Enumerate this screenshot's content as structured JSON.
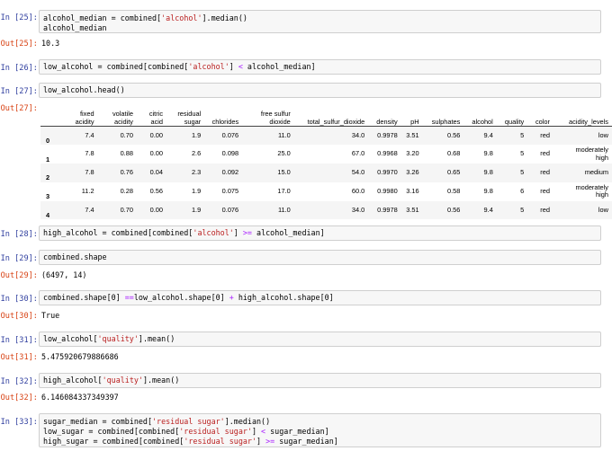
{
  "cells": [
    {
      "in": "In [25]:",
      "out": "Out[25]:",
      "output": "10.3"
    },
    {
      "in": "In [26]:"
    },
    {
      "in": "In [27]:",
      "out": "Out[27]:"
    },
    {
      "in": "In [28]:"
    },
    {
      "in": "In [29]:",
      "out": "Out[29]:",
      "output": "(6497, 14)"
    },
    {
      "in": "In [30]:",
      "out": "Out[30]:",
      "output": "True"
    },
    {
      "in": "In [31]:",
      "out": "Out[31]:",
      "output": "5.475920679886686"
    },
    {
      "in": "In [32]:",
      "out": "Out[32]:",
      "output": "6.146084337349397"
    },
    {
      "in": "In [33]:"
    }
  ],
  "code": {
    "c25_l1": "alcohol_median = combined[",
    "c25_s1": "'alcohol'",
    "c25_l1b": "].median()",
    "c25_l2": "alcohol_median",
    "c26_a": "low_alcohol = combined[combined[",
    "c26_s": "'alcohol'",
    "c26_b": "] ",
    "c26_op": "<",
    "c26_c": " alcohol_median]",
    "c27": "low_alcohol.head()",
    "c28_a": "high_alcohol = combined[combined[",
    "c28_s": "'alcohol'",
    "c28_b": "] ",
    "c28_op": ">=",
    "c28_c": " alcohol_median]",
    "c29": "combined.shape",
    "c30_a": "combined.shape[0] ",
    "c30_op1": "==",
    "c30_b": "low_alcohol.shape[0] ",
    "c30_op2": "+",
    "c30_c": " high_alcohol.shape[0]",
    "c31_a": "low_alcohol[",
    "c31_s": "'quality'",
    "c31_b": "].mean()",
    "c32_a": "high_alcohol[",
    "c32_s": "'quality'",
    "c32_b": "].mean()",
    "c33_l1a": "sugar_median = combined[",
    "c33_l1s": "'residual sugar'",
    "c33_l1b": "].median()",
    "c33_l2a": "low_sugar = combined[combined[",
    "c33_l2s": "'residual sugar'",
    "c33_l2b": "] ",
    "c33_l2op": "<",
    "c33_l2c": " sugar_median]",
    "c33_l3a": "high_sugar = combined[combined[",
    "c33_l3s": "'residual sugar'",
    "c33_l3b": "] ",
    "c33_l3op": ">=",
    "c33_l3c": " sugar_median]"
  },
  "table": {
    "columns": [
      "",
      "fixed\nacidity",
      "volatile\nacidity",
      "citric\nacid",
      "residual\nsugar",
      "chlorides",
      "free sulfur\ndioxide",
      "total_sulfur_dioxide",
      "density",
      "pH",
      "sulphates",
      "alcohol",
      "quality",
      "color",
      "acidity_levels"
    ],
    "rows": [
      [
        "0",
        "7.4",
        "0.70",
        "0.00",
        "1.9",
        "0.076",
        "11.0",
        "34.0",
        "0.9978",
        "3.51",
        "0.56",
        "9.4",
        "5",
        "red",
        "low"
      ],
      [
        "1",
        "7.8",
        "0.88",
        "0.00",
        "2.6",
        "0.098",
        "25.0",
        "67.0",
        "0.9968",
        "3.20",
        "0.68",
        "9.8",
        "5",
        "red",
        "moderately\nhigh"
      ],
      [
        "2",
        "7.8",
        "0.76",
        "0.04",
        "2.3",
        "0.092",
        "15.0",
        "54.0",
        "0.9970",
        "3.26",
        "0.65",
        "9.8",
        "5",
        "red",
        "medium"
      ],
      [
        "3",
        "11.2",
        "0.28",
        "0.56",
        "1.9",
        "0.075",
        "17.0",
        "60.0",
        "0.9980",
        "3.16",
        "0.58",
        "9.8",
        "6",
        "red",
        "moderately\nhigh"
      ],
      [
        "4",
        "7.4",
        "0.70",
        "0.00",
        "1.9",
        "0.076",
        "11.0",
        "34.0",
        "0.9978",
        "3.51",
        "0.56",
        "9.4",
        "5",
        "red",
        "low"
      ]
    ]
  }
}
